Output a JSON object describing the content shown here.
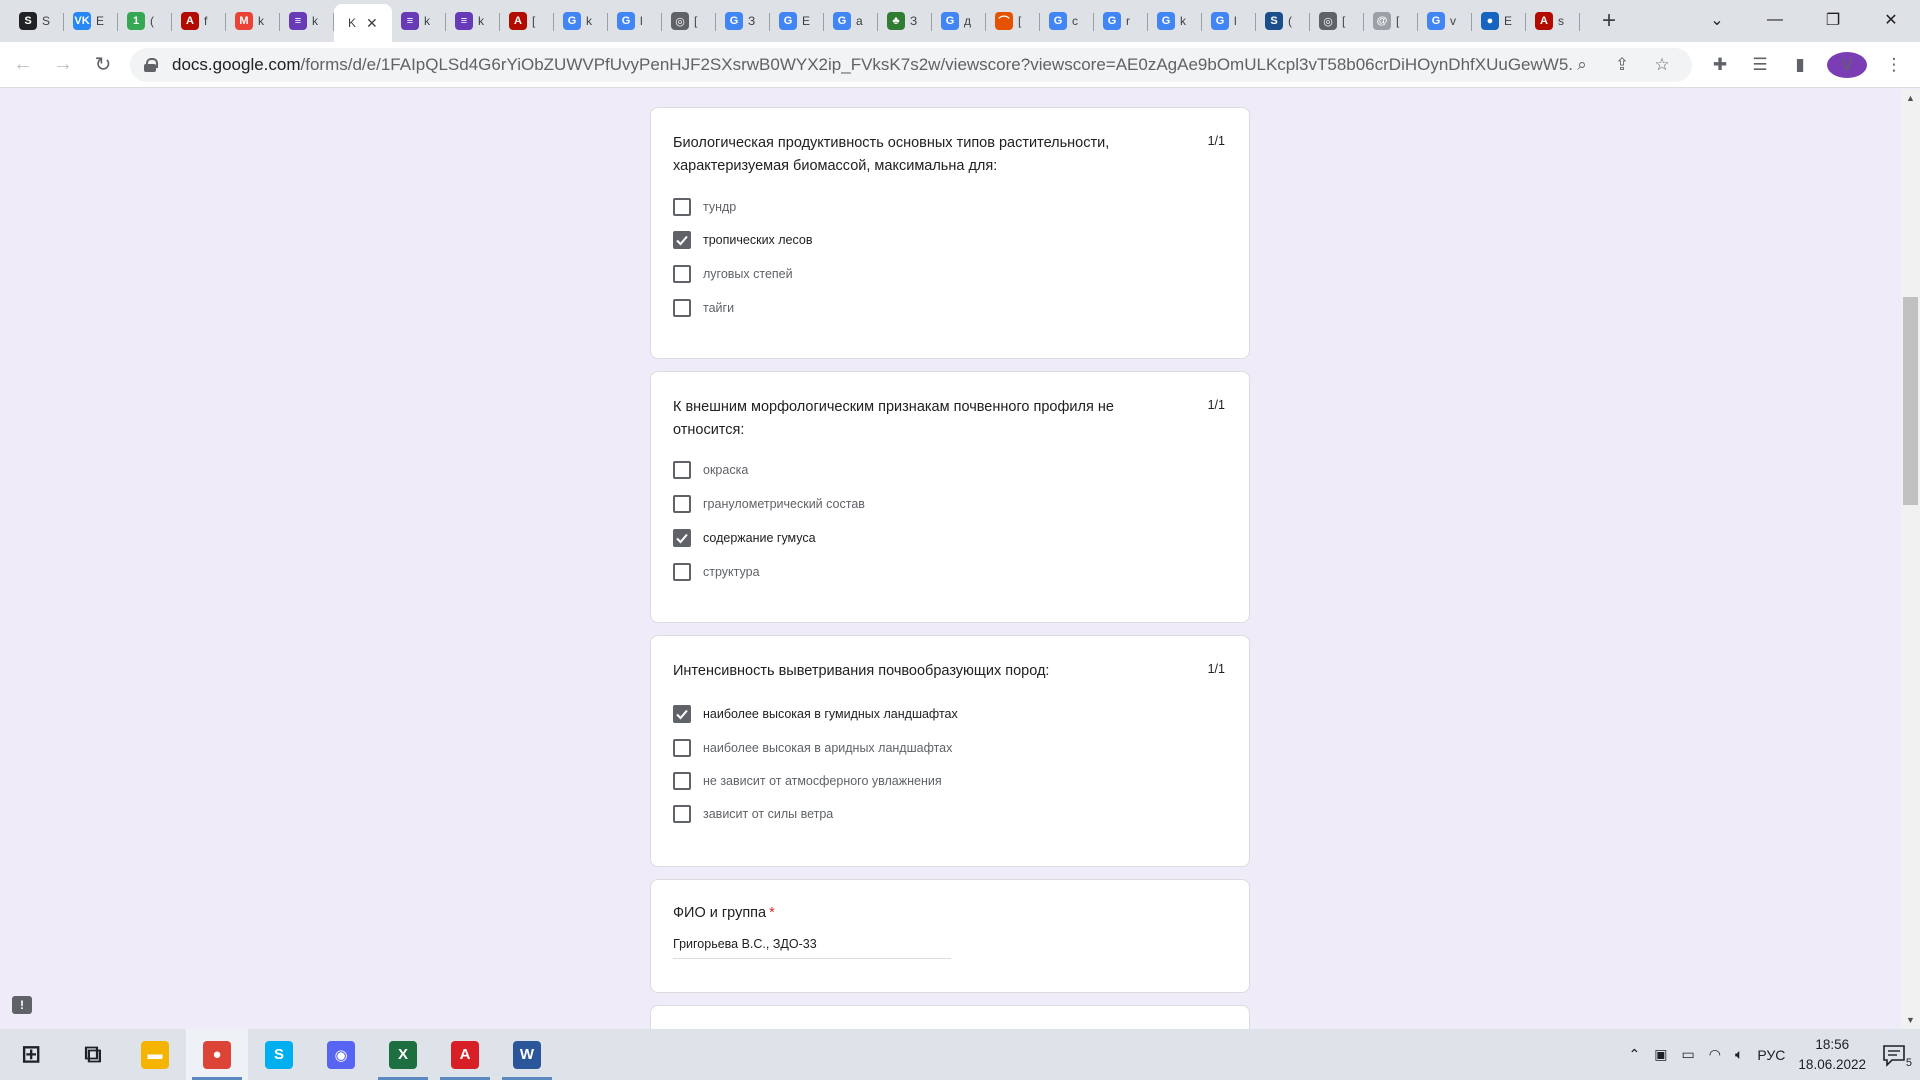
{
  "browser": {
    "tabs": [
      {
        "icon": "generic-site-icon",
        "letter": "S",
        "color": "#202124",
        "text": "S"
      },
      {
        "icon": "vk-icon",
        "letter": "VK",
        "color": "#2787f5",
        "text": "E"
      },
      {
        "icon": "green-number-icon",
        "letter": "1",
        "color": "#34a853",
        "text": "("
      },
      {
        "icon": "pdf-icon",
        "letter": "A",
        "color": "#b30b00",
        "text": "f"
      },
      {
        "icon": "gmail-icon",
        "letter": "M",
        "color": "#ea4335",
        "text": "k"
      },
      {
        "icon": "forms-icon",
        "letter": "≡",
        "color": "#673ab7",
        "text": "k"
      },
      {
        "icon": "active-tab",
        "letter": "",
        "color": "#ffffff",
        "text": "K",
        "active": true
      },
      {
        "icon": "forms-icon",
        "letter": "≡",
        "color": "#673ab7",
        "text": "k"
      },
      {
        "icon": "forms-icon",
        "letter": "≡",
        "color": "#673ab7",
        "text": "k"
      },
      {
        "icon": "pdf-icon",
        "letter": "A",
        "color": "#b30b00",
        "text": "["
      },
      {
        "icon": "google-icon",
        "letter": "G",
        "color": "#4285f4",
        "text": "k"
      },
      {
        "icon": "google-icon",
        "letter": "G",
        "color": "#4285f4",
        "text": "l"
      },
      {
        "icon": "globe-icon",
        "letter": "◎",
        "color": "#5f6368",
        "text": "["
      },
      {
        "icon": "google-icon",
        "letter": "G",
        "color": "#4285f4",
        "text": "З"
      },
      {
        "icon": "google-icon",
        "letter": "G",
        "color": "#4285f4",
        "text": "E"
      },
      {
        "icon": "google-icon",
        "letter": "G",
        "color": "#4285f4",
        "text": "a"
      },
      {
        "icon": "tree-icon",
        "letter": "♣",
        "color": "#2e7d32",
        "text": "З"
      },
      {
        "icon": "google-icon",
        "letter": "G",
        "color": "#4285f4",
        "text": "д"
      },
      {
        "icon": "rainbow-icon",
        "letter": "⌒",
        "color": "#e65100",
        "text": "["
      },
      {
        "icon": "google-icon",
        "letter": "G",
        "color": "#4285f4",
        "text": "c"
      },
      {
        "icon": "google-icon",
        "letter": "G",
        "color": "#4285f4",
        "text": "r"
      },
      {
        "icon": "google-icon",
        "letter": "G",
        "color": "#4285f4",
        "text": "k"
      },
      {
        "icon": "google-icon",
        "letter": "G",
        "color": "#4285f4",
        "text": "l"
      },
      {
        "icon": "s-logo-icon",
        "letter": "S",
        "color": "#1a4f8b",
        "text": "("
      },
      {
        "icon": "globe-icon",
        "letter": "◎",
        "color": "#5f6368",
        "text": "["
      },
      {
        "icon": "at-icon",
        "letter": "@",
        "color": "#9aa0a6",
        "text": "["
      },
      {
        "icon": "google-icon",
        "letter": "G",
        "color": "#4285f4",
        "text": "v"
      },
      {
        "icon": "earth-icon",
        "letter": "●",
        "color": "#1565c0",
        "text": "E"
      },
      {
        "icon": "pdf-icon",
        "letter": "A",
        "color": "#b30b00",
        "text": "s"
      }
    ],
    "new_tab_label": "+",
    "url_host": "docs.google.com",
    "url_path": "/forms/d/e/1FAIpQLSd4G6rYiObZUWVPfUvyPenHJF2SXsrwB0WYX2ip_FVksK7s2w/viewscore?viewscore=AE0zAgAe9bOmULKcpl3vT58b06crDiHOynDhfXUuGewW5...",
    "profile_letter": "V",
    "profile_color": "#7b3db3"
  },
  "form": {
    "questions": [
      {
        "title": "Биологическая продуктивность основных типов растительности, характеризуемая биомассой, максимальна для:",
        "score": "1/1",
        "options": [
          {
            "label": "тундр",
            "checked": false
          },
          {
            "label": "тропических лесов",
            "checked": true
          },
          {
            "label": "луговых степей",
            "checked": false
          },
          {
            "label": "тайги",
            "checked": false
          }
        ]
      },
      {
        "title": "К внешним морфологическим признакам почвенного профиля не относится:",
        "score": "1/1",
        "options": [
          {
            "label": "окраска",
            "checked": false
          },
          {
            "label": "гранулометрический состав",
            "checked": false
          },
          {
            "label": "содержание гумуса",
            "checked": true
          },
          {
            "label": "структура",
            "checked": false
          }
        ]
      },
      {
        "title": "Интенсивность выветривания почвообразующих пород:",
        "score": "1/1",
        "options": [
          {
            "label": "наиболее высокая в гумидных ландшафтах",
            "checked": true
          },
          {
            "label": "наиболее высокая в аридных ландшафтах",
            "checked": false
          },
          {
            "label": "не зависит от атмосферного увлажнения",
            "checked": false
          },
          {
            "label": "зависит от силы ветра",
            "checked": false
          }
        ]
      }
    ],
    "name_field": {
      "label": "ФИО и группа",
      "required_mark": "*",
      "value": "Григорьева В.С., ЗДО-33"
    },
    "feedback_icon": "!"
  },
  "taskbar": {
    "apps": [
      {
        "name": "start-button",
        "icon": "windows-icon",
        "label": "⊞",
        "color": "#202124"
      },
      {
        "name": "task-view-button",
        "icon": "task-view-icon",
        "label": "⧉",
        "color": "#202124"
      },
      {
        "name": "explorer-button",
        "icon": "folder-icon",
        "label": "▬",
        "color": "#f4b400"
      },
      {
        "name": "chrome-button",
        "icon": "chrome-icon",
        "label": "●",
        "color": "#db4437",
        "running": true,
        "active": true
      },
      {
        "name": "skype-button",
        "icon": "skype-icon",
        "label": "S",
        "color": "#00aff0"
      },
      {
        "name": "discord-button",
        "icon": "discord-icon",
        "label": "◉",
        "color": "#5865f2"
      },
      {
        "name": "excel-button",
        "icon": "excel-icon",
        "label": "X",
        "color": "#1d6f42",
        "running": true
      },
      {
        "name": "acrobat-button",
        "icon": "acrobat-icon",
        "label": "A",
        "color": "#d81f26",
        "running": true
      },
      {
        "name": "word-button",
        "icon": "word-icon",
        "label": "W",
        "color": "#2b579a",
        "running": true
      }
    ],
    "language": "РУС",
    "time": "18:56",
    "date": "18.06.2022",
    "notification_count": "5"
  }
}
